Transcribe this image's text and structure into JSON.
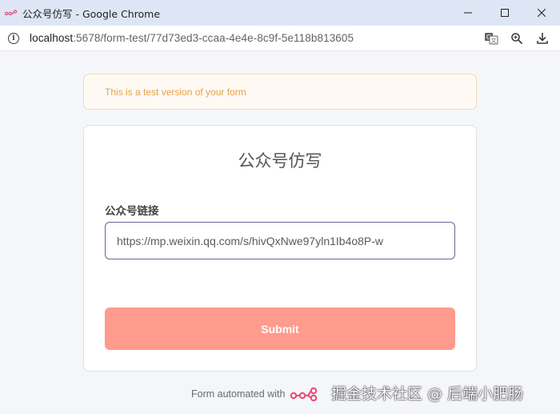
{
  "window": {
    "title": "公众号仿写 - Google Chrome",
    "controls": [
      "minimize-icon",
      "maximize-icon",
      "close-icon"
    ]
  },
  "address_bar": {
    "url_host": "localhost",
    "url_rest": ":5678/form-test/77d73ed3-ccaa-4e4e-8c9f-5e118b813605",
    "actions": [
      "translate-icon",
      "zoom-icon",
      "download-icon"
    ]
  },
  "banner": {
    "text": "This is a test version of your form"
  },
  "form": {
    "title": "公众号仿写",
    "field_label": "公众号链接",
    "field_value": "https://mp.weixin.qq.com/s/hivQxNwe97yln1Ib4o8P-w",
    "submit_label": "Submit"
  },
  "footer": {
    "text": "Form automated with"
  },
  "watermark": {
    "text": "掘金技术社区 @ 后端小肥肠"
  },
  "colors": {
    "accent": "#ff9b8d",
    "banner_text": "#e3a24b",
    "n8n_pink": "#ea4b71"
  }
}
